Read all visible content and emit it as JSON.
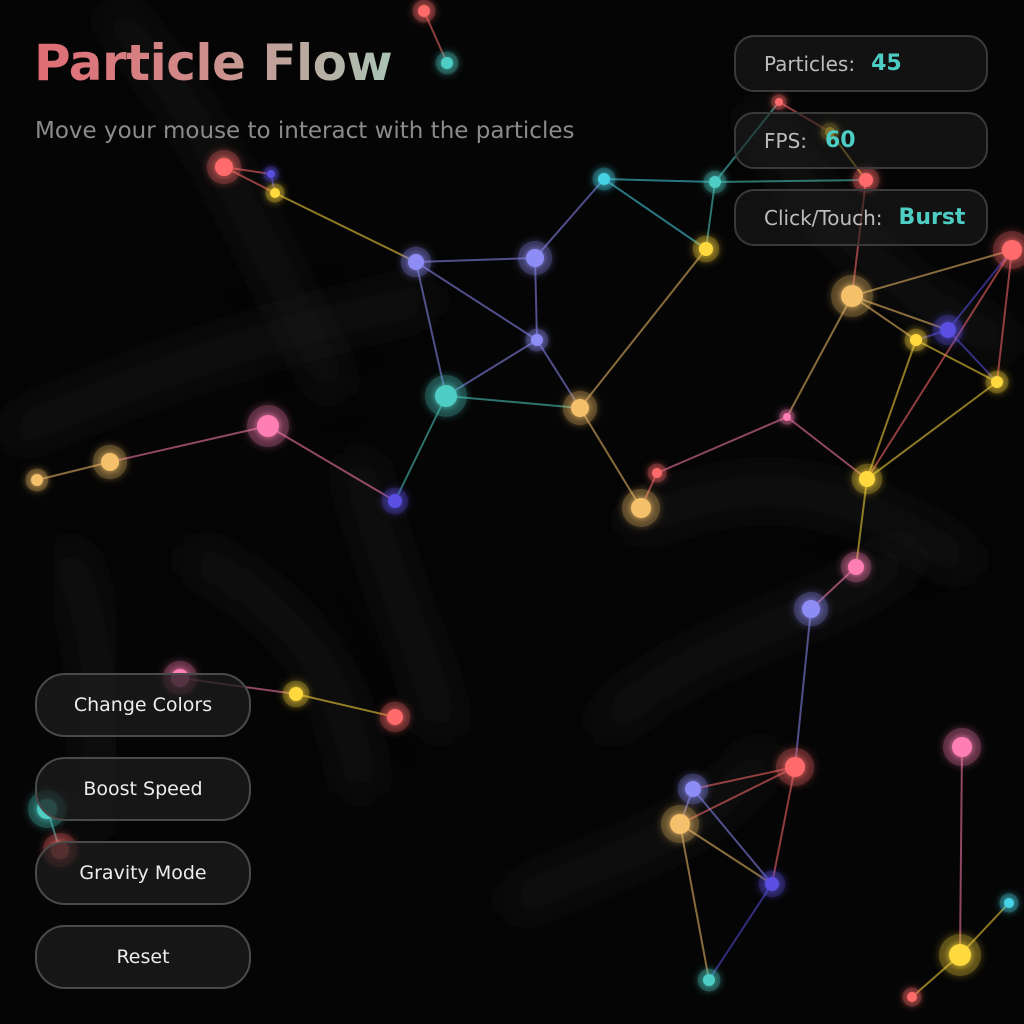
{
  "header": {
    "title": "Particle Flow",
    "subtitle": "Move your mouse to interact with the particles"
  },
  "stats": {
    "particles_label": "Particles:",
    "particles_value": "45",
    "fps_label": "FPS:",
    "fps_value": "60",
    "click_label": "Click/Touch:",
    "click_value": "Burst"
  },
  "controls": {
    "change_colors": "Change Colors",
    "boost_speed": "Boost Speed",
    "gravity_mode": "Gravity Mode",
    "reset": "Reset"
  },
  "colors": {
    "background": "#050505",
    "accent": "#4ecdc4",
    "palette": [
      "#ff6b6b",
      "#4ecdc4",
      "#ffd93d",
      "#8e8cf5",
      "#ff7eb3",
      "#f4c06a",
      "#5a4fe0",
      "#47d3e6"
    ]
  }
}
